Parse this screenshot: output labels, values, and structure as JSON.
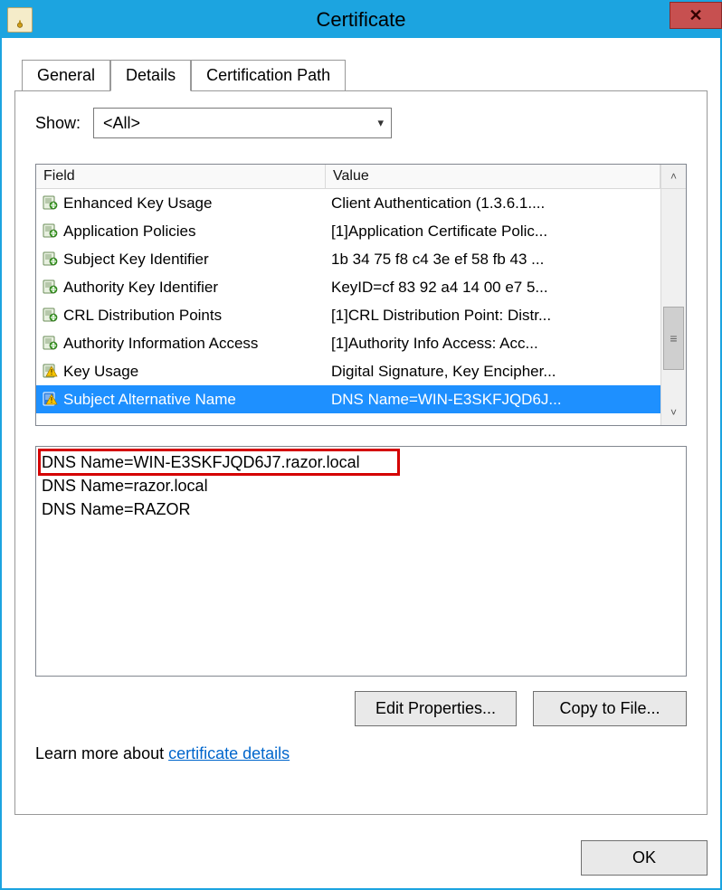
{
  "window": {
    "title": "Certificate"
  },
  "tabs": {
    "general": "General",
    "details": "Details",
    "certpath": "Certification Path"
  },
  "show": {
    "label": "Show:",
    "value": "<All>"
  },
  "columns": {
    "field": "Field",
    "value": "Value"
  },
  "rows": [
    {
      "field": "Enhanced Key Usage",
      "value": "Client Authentication (1.3.6.1....",
      "warn": false
    },
    {
      "field": "Application Policies",
      "value": "[1]Application Certificate Polic...",
      "warn": false
    },
    {
      "field": "Subject Key Identifier",
      "value": "1b 34 75 f8 c4 3e ef 58 fb 43 ...",
      "warn": false
    },
    {
      "field": "Authority Key Identifier",
      "value": "KeyID=cf 83 92 a4 14 00 e7 5...",
      "warn": false
    },
    {
      "field": "CRL Distribution Points",
      "value": "[1]CRL Distribution Point: Distr...",
      "warn": false
    },
    {
      "field": "Authority Information Access",
      "value": "[1]Authority Info Access: Acc...",
      "warn": false
    },
    {
      "field": "Key Usage",
      "value": "Digital Signature, Key Encipher...",
      "warn": true
    },
    {
      "field": "Subject Alternative Name",
      "value": "DNS Name=WIN-E3SKFJQD6J...",
      "warn": true,
      "selected": true
    }
  ],
  "details": {
    "lines": [
      "DNS Name=WIN-E3SKFJQD6J7.razor.local",
      "DNS Name=razor.local",
      "DNS Name=RAZOR"
    ]
  },
  "buttons": {
    "editprops": "Edit Properties...",
    "copytofile": "Copy to File...",
    "ok": "OK"
  },
  "learnmore": {
    "prefix": "Learn more about ",
    "link": "certificate details"
  }
}
